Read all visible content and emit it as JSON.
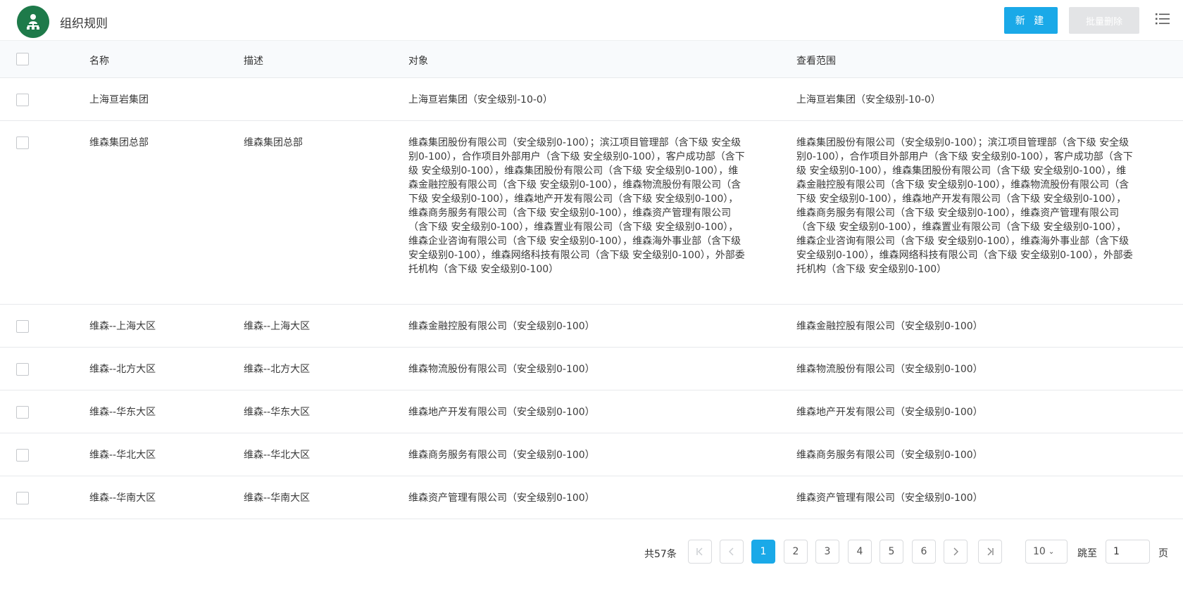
{
  "header": {
    "title": "组织规则",
    "new_button": "新 建",
    "batch_delete_button": "批量删除",
    "accent_color": "#1aa9e8",
    "logo_color": "#1e7a4a"
  },
  "table": {
    "columns": [
      "名称",
      "描述",
      "对象",
      "查看范围"
    ],
    "rows": [
      {
        "name": "上海亘岩集团",
        "desc": "",
        "object": "上海亘岩集团（安全级别-10-0）",
        "scope": "上海亘岩集团（安全级别-10-0）"
      },
      {
        "name": "维森集团总部",
        "desc": "维森集团总部",
        "object": "维森集团股份有限公司（安全级别0-100）；滨江项目管理部（含下级 安全级别0-100），合作项目外部用户（含下级 安全级别0-100），客户成功部（含下级 安全级别0-100），维森集团股份有限公司（含下级 安全级别0-100），维森金融控股有限公司（含下级 安全级别0-100），维森物流股份有限公司（含下级 安全级别0-100），维森地产开发有限公司（含下级 安全级别0-100），维森商务服务有限公司（含下级 安全级别0-100），维森资产管理有限公司（含下级 安全级别0-100），维森置业有限公司（含下级 安全级别0-100），维森企业咨询有限公司（含下级 安全级别0-100），维森海外事业部（含下级 安全级别0-100），维森网络科技有限公司（含下级 安全级别0-100），外部委托机构（含下级 安全级别0-100）",
        "scope": "维森集团股份有限公司（安全级别0-100）；滨江项目管理部（含下级 安全级别0-100），合作项目外部用户（含下级 安全级别0-100），客户成功部（含下级 安全级别0-100），维森集团股份有限公司（含下级 安全级别0-100），维森金融控股有限公司（含下级 安全级别0-100），维森物流股份有限公司（含下级 安全级别0-100），维森地产开发有限公司（含下级 安全级别0-100），维森商务服务有限公司（含下级 安全级别0-100），维森资产管理有限公司（含下级 安全级别0-100），维森置业有限公司（含下级 安全级别0-100），维森企业咨询有限公司（含下级 安全级别0-100），维森海外事业部（含下级 安全级别0-100），维森网络科技有限公司（含下级 安全级别0-100），外部委托机构（含下级 安全级别0-100）"
      },
      {
        "name": "维森--上海大区",
        "desc": "维森--上海大区",
        "object": "维森金融控股有限公司（安全级别0-100）",
        "scope": "维森金融控股有限公司（安全级别0-100）"
      },
      {
        "name": "维森--北方大区",
        "desc": "维森--北方大区",
        "object": "维森物流股份有限公司（安全级别0-100）",
        "scope": "维森物流股份有限公司（安全级别0-100）"
      },
      {
        "name": "维森--华东大区",
        "desc": "维森--华东大区",
        "object": "维森地产开发有限公司（安全级别0-100）",
        "scope": "维森地产开发有限公司（安全级别0-100）"
      },
      {
        "name": "维森--华北大区",
        "desc": "维森--华北大区",
        "object": "维森商务服务有限公司（安全级别0-100）",
        "scope": "维森商务服务有限公司（安全级别0-100）"
      },
      {
        "name": "维森--华南大区",
        "desc": "维森--华南大区",
        "object": "维森资产管理有限公司（安全级别0-100）",
        "scope": "维森资产管理有限公司（安全级别0-100）"
      }
    ]
  },
  "pagination": {
    "total": "共57条",
    "pages": [
      "1",
      "2",
      "3",
      "4",
      "5",
      "6"
    ],
    "current": "1",
    "page_size": "10",
    "jump_label": "跳至",
    "jump_value": "1",
    "page_suffix": "页"
  }
}
